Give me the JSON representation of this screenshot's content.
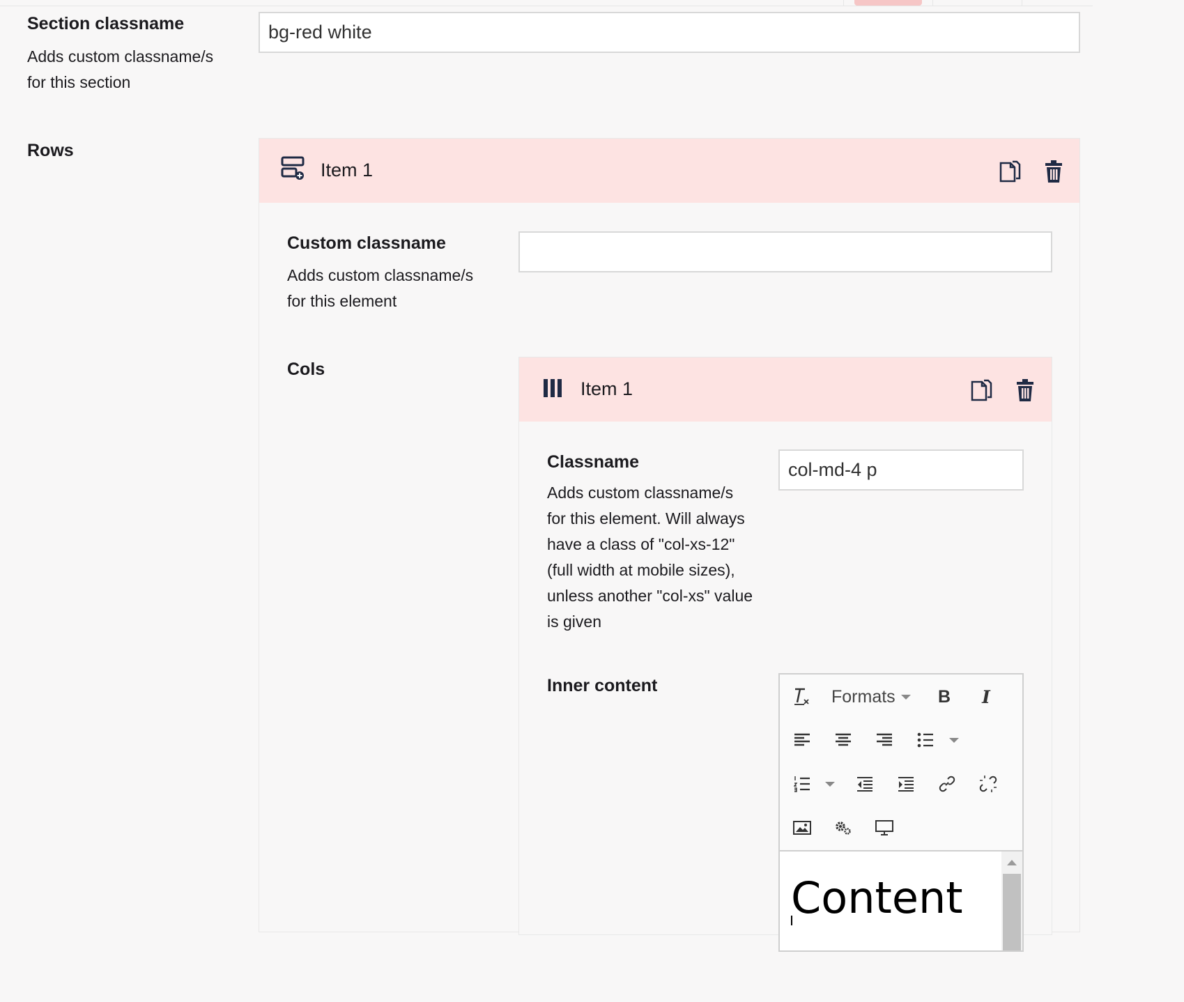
{
  "section": {
    "classname_label": "Section classname",
    "classname_desc_line1": "Adds custom classname/s",
    "classname_desc_line2": "for this section",
    "classname_value": "bg-red white",
    "rows_label": "Rows"
  },
  "row_item": {
    "title": "Item 1",
    "icon": "row-add-icon",
    "custom_label": "Custom classname",
    "custom_desc_line1": "Adds custom classname/s",
    "custom_desc_line2": "for this element",
    "custom_value": "",
    "cols_label": "Cols"
  },
  "col_item": {
    "title": "Item 1",
    "icon": "columns-icon",
    "classname_label": "Classname",
    "classname_desc": [
      "Adds custom classname/s",
      "for this element. Will always",
      "have a class of \"col-xs-12\"",
      "(full width at mobile sizes),",
      "unless another \"col-xs\" value",
      "is given"
    ],
    "classname_value": "col-md-4 p",
    "inner_label": "Inner content"
  },
  "editor": {
    "formats_label": "Formats",
    "bold_label": "B",
    "italic_label": "I",
    "content_text": "Content"
  },
  "colors": {
    "header_bg": "#fde3e2",
    "page_bg": "#f8f7f7",
    "text": "#1b1a1e",
    "icon": "#1f2a44"
  }
}
